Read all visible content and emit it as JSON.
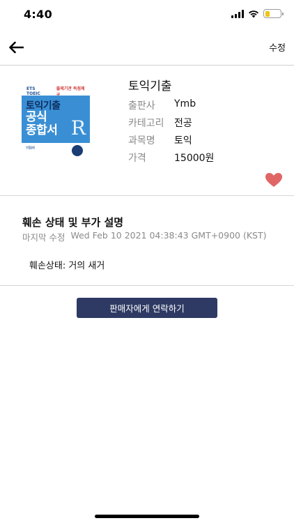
{
  "status_bar": {
    "time": "4:40",
    "battery_level": 0.3,
    "battery_color": "#f1c40f"
  },
  "nav": {
    "edit_label": "수정"
  },
  "book": {
    "cover": {
      "brand": "ETS TOEIC",
      "promo": "출제기관 독점제공",
      "title_line1": "토익기출",
      "title_line2": "공식",
      "title_line3": "종합서",
      "edition_mark": "R",
      "publisher": "YBM"
    },
    "title": "토익기출",
    "info": [
      {
        "label": "출판사",
        "value": "Ymb"
      },
      {
        "label": "카테고리",
        "value": "전공"
      },
      {
        "label": "과목명",
        "value": "토익"
      },
      {
        "label": "가격",
        "value": "15000원"
      }
    ],
    "favorite": true,
    "heart_color": "#e06666"
  },
  "description": {
    "heading": "훼손 상태 및 부가 설명",
    "modified_label": "마지막 수정",
    "modified_value": "Wed Feb 10 2021 04:38:43 GMT+0900 (KST)",
    "condition_text": "훼손상태: 거의 새거"
  },
  "contact_button": {
    "label": "판매자에게 연락하기",
    "color": "#2e3a63"
  }
}
